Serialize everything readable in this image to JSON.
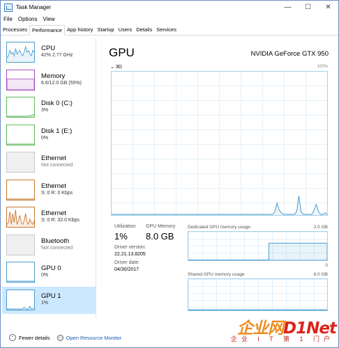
{
  "window": {
    "title": "Task Manager",
    "controls": {
      "minimize": "—",
      "maximize": "☐",
      "close": "✕"
    }
  },
  "menu": [
    "File",
    "Options",
    "View"
  ],
  "tabs": [
    "Processes",
    "Performance",
    "App history",
    "Startup",
    "Users",
    "Details",
    "Services"
  ],
  "active_tab": "Performance",
  "sidebar": {
    "items": [
      {
        "title": "CPU",
        "sub": "42%  2.77 GHz",
        "color": "#4a9ccf",
        "muted": false,
        "spark": [
          0.2,
          0.3,
          0.6,
          0.4,
          0.5,
          0.3,
          0.7,
          0.4,
          0.5,
          0.6,
          0.4,
          0.3,
          0.5,
          0.8,
          0.5,
          0.6,
          0.4,
          0.3,
          0.6,
          0.5
        ]
      },
      {
        "title": "Memory",
        "sub": "6.6/12.0 GB (55%)",
        "color": "#a64dbf",
        "muted": false,
        "fill": 0.55
      },
      {
        "title": "Disk 0 (C:)",
        "sub": "3%",
        "color": "#5cb85c",
        "muted": false,
        "spark": [
          0,
          0,
          0,
          0,
          0,
          0,
          0,
          0,
          0,
          0,
          0,
          0,
          0,
          0,
          0,
          0,
          0.05,
          0,
          0.1,
          0.03
        ]
      },
      {
        "title": "Disk 1 (E:)",
        "sub": "0%",
        "color": "#5cb85c",
        "muted": false,
        "spark": [
          0,
          0,
          0,
          0,
          0,
          0,
          0,
          0,
          0,
          0,
          0,
          0,
          0,
          0,
          0,
          0,
          0,
          0,
          0,
          0
        ]
      },
      {
        "title": "Ethernet",
        "sub": "Not connected",
        "color": "#c8c8c8",
        "muted": true,
        "disconnected": true
      },
      {
        "title": "Ethernet",
        "sub": "S: 0  R: 0 Kbps",
        "color": "#c8772e",
        "muted": false,
        "spark": [
          0,
          0,
          0,
          0,
          0,
          0,
          0,
          0,
          0,
          0,
          0,
          0,
          0,
          0,
          0,
          0,
          0,
          0,
          0,
          0
        ]
      },
      {
        "title": "Ethernet",
        "sub": "S: 0  R: 32.0 Kbps",
        "color": "#c8772e",
        "muted": false,
        "spark": [
          0.1,
          0.2,
          0.8,
          0.1,
          0.7,
          0.2,
          0.9,
          0.1,
          0.3,
          0.6,
          0.2,
          0.1,
          0.3,
          0.7,
          0.2,
          0.1,
          0.4,
          0.2,
          0.1,
          0.3
        ]
      },
      {
        "title": "Bluetooth",
        "sub": "Not connected",
        "color": "#c8c8c8",
        "muted": true,
        "disconnected": true
      },
      {
        "title": "GPU 0",
        "sub": "0%",
        "color": "#4a9ccf",
        "muted": false,
        "spark": [
          0,
          0,
          0,
          0,
          0,
          0,
          0,
          0,
          0,
          0,
          0,
          0,
          0,
          0,
          0,
          0,
          0,
          0,
          0,
          0
        ]
      },
      {
        "title": "GPU 1",
        "sub": "1%",
        "color": "#4a9ccf",
        "muted": false,
        "selected": true,
        "spark": [
          0,
          0,
          0,
          0,
          0,
          0,
          0,
          0,
          0,
          0,
          0,
          0,
          0.1,
          0,
          0,
          0,
          0.15,
          0,
          0.05,
          0.02
        ]
      }
    ]
  },
  "main": {
    "title": "GPU",
    "gpu_name": "NVIDIA GeForce GTX 950",
    "engine_label": "3D",
    "max_label": "100%",
    "chart_color": "#4a9ccf",
    "utilization_series": [
      0,
      0,
      0,
      0,
      0,
      0,
      0,
      0,
      0,
      0,
      0,
      0,
      0,
      0,
      0,
      0,
      0,
      0,
      0,
      0,
      0,
      0,
      0,
      0,
      0,
      0,
      0,
      0,
      0,
      0,
      0,
      0,
      0,
      0,
      0,
      0,
      0,
      0,
      0,
      0,
      0,
      0,
      0,
      0,
      0,
      0,
      0,
      0,
      0,
      0,
      0,
      0,
      0,
      0,
      0,
      0,
      0,
      0,
      0,
      0,
      0,
      0,
      0,
      0,
      0,
      0,
      0,
      0,
      0,
      0,
      0,
      0,
      0,
      0,
      0,
      0.02,
      0.08,
      0.03,
      0.01,
      0,
      0,
      0,
      0,
      0,
      0,
      0.02,
      0.13,
      0.02,
      0,
      0,
      0,
      0,
      0,
      0.03,
      0.07,
      0.02,
      0,
      0,
      0.01,
      0
    ],
    "stats": {
      "utilization_label": "Utilization",
      "utilization_value": "1%",
      "gpu_memory_label": "GPU Memory",
      "gpu_memory_value": "8.0 GB",
      "driver_version_label": "Driver version:",
      "driver_version_value": "22.21.13.8205",
      "driver_date_label": "Driver date:",
      "driver_date_value": "04/30/2017"
    },
    "dedicated": {
      "label": "Dedicated GPU memory usage",
      "max": "2.0 GB",
      "min": "0",
      "fill": 0.6
    },
    "shared": {
      "label": "Shared GPU memory usage",
      "max": "6.0 GB",
      "min": "0",
      "fill": 0.02
    }
  },
  "footer": {
    "fewer_details": "Fewer details",
    "open_resource_monitor": "Open Resource Monitor"
  },
  "watermark": {
    "brand_a": "企业网",
    "brand_b": "D1Net",
    "tagline": "企业 I T 第 1 门户"
  }
}
